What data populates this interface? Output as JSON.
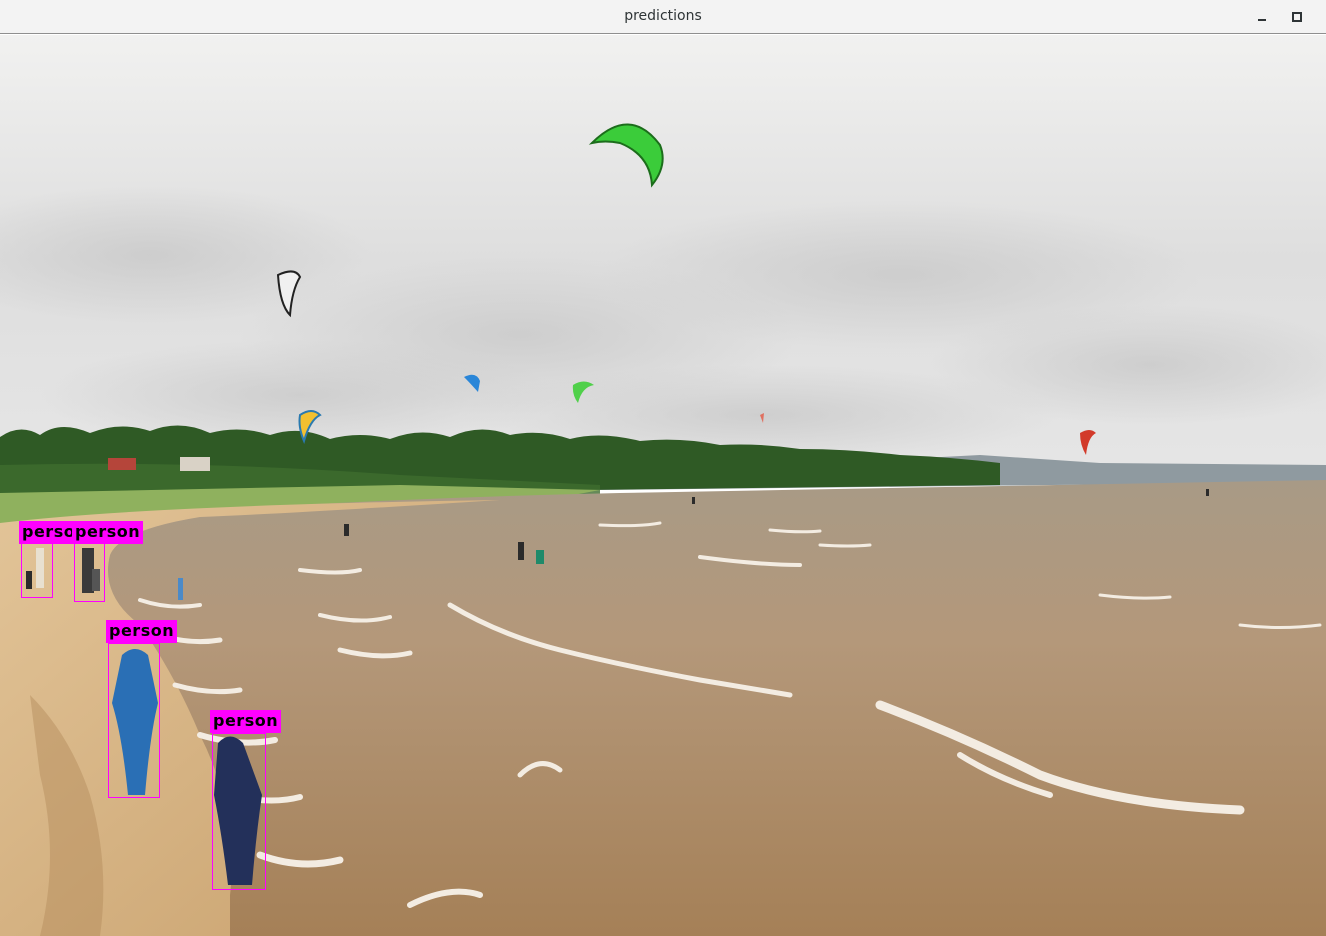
{
  "window": {
    "title": "predictions",
    "controls": [
      "minimize",
      "maximize"
    ]
  },
  "detections": [
    {
      "label": "person"
    },
    {
      "label": "person"
    },
    {
      "label": "person"
    },
    {
      "label": "person"
    }
  ],
  "colors": {
    "box": "#ff00ff",
    "label_bg": "#ff00ff",
    "label_text": "#000000"
  }
}
